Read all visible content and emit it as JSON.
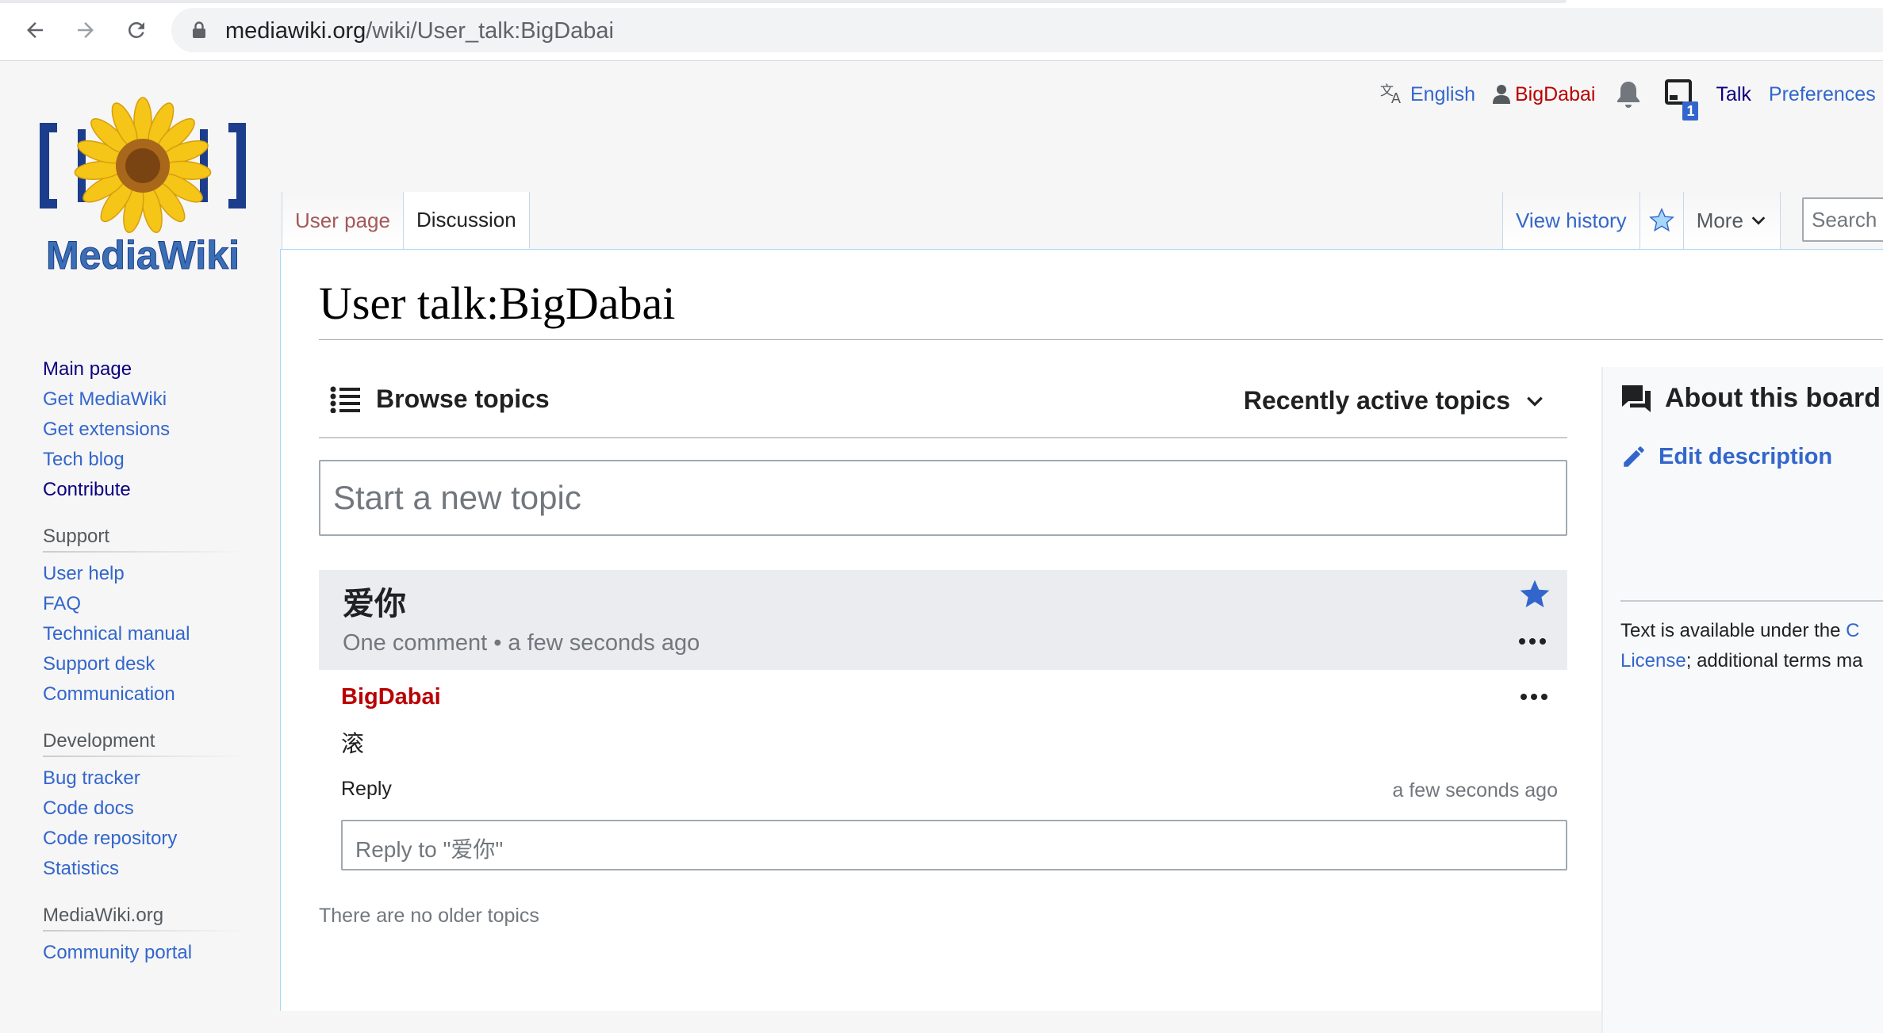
{
  "browser": {
    "url_host": "mediawiki.org",
    "url_path": "/wiki/User_talk:BigDabai"
  },
  "logo": {
    "text": "MediaWiki"
  },
  "personal": {
    "language": "English",
    "username": "BigDabai",
    "notifications_count": "1",
    "talk": "Talk",
    "preferences": "Preferences"
  },
  "tabs": {
    "user_page": "User page",
    "discussion": "Discussion",
    "view_history": "View history",
    "more": "More",
    "search_placeholder": "Search"
  },
  "sidebar": {
    "nav": [
      "Main page",
      "Get MediaWiki",
      "Get extensions",
      "Tech blog",
      "Contribute"
    ],
    "support_heading": "Support",
    "support": [
      "User help",
      "FAQ",
      "Technical manual",
      "Support desk",
      "Communication"
    ],
    "development_heading": "Development",
    "development": [
      "Bug tracker",
      "Code docs",
      "Code repository",
      "Statistics"
    ],
    "mediawiki_heading": "MediaWiki.org",
    "mediawiki": [
      "Community portal"
    ]
  },
  "main": {
    "title": "User talk:BigDabai",
    "browse_topics": "Browse topics",
    "sort_label": "Recently active topics",
    "new_topic_placeholder": "Start a new topic",
    "topic": {
      "title": "爱你",
      "comments": "One comment",
      "time": "a few seconds ago"
    },
    "post": {
      "author": "BigDabai",
      "body": "滚",
      "reply": "Reply",
      "time": "a few seconds ago"
    },
    "reply_placeholder": "Reply to \"爱你\"",
    "no_older": "There are no older topics"
  },
  "board": {
    "title": "About this board",
    "edit_description": "Edit description",
    "license_prefix": "Text is available under the ",
    "license_link1": "C",
    "license_link2": "License",
    "license_suffix": "; additional terms ma"
  },
  "colors": {
    "link": "#3366cc",
    "red_link": "#ba0000",
    "topic_bg": "#eaecf0"
  }
}
